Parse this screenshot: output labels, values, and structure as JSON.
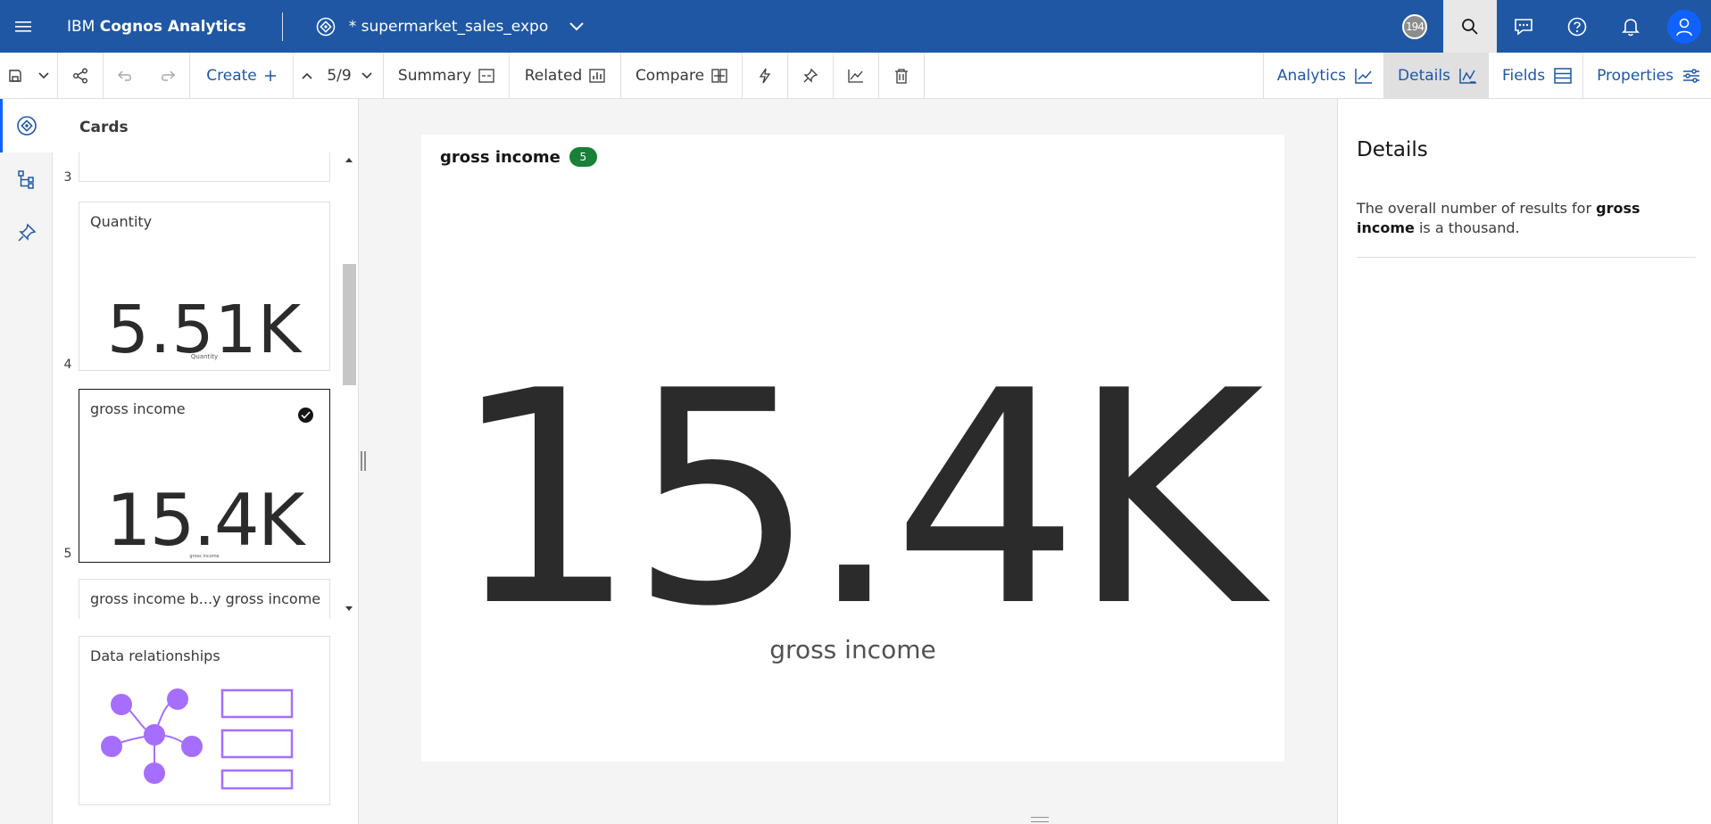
{
  "topbar": {
    "brand_prefix": "IBM ",
    "brand_name": "Cognos Analytics",
    "document_title": "* supermarket_sales_expo",
    "notification_count": "194"
  },
  "toolbar": {
    "create_label": "Create",
    "position": "5/9",
    "summary_label": "Summary",
    "related_label": "Related",
    "compare_label": "Compare",
    "analytics_label": "Analytics",
    "details_label": "Details",
    "fields_label": "Fields",
    "properties_label": "Properties"
  },
  "cards_panel": {
    "title": "Cards",
    "cards": [
      {
        "number": "3",
        "label": ""
      },
      {
        "number": "4",
        "label": "Quantity",
        "value": "5.51K",
        "sub": "Quantity"
      },
      {
        "number": "5",
        "label": "gross income",
        "value": "15.4K",
        "sub": "gross income",
        "selected": true
      },
      {
        "number": "",
        "label": "gross income b...y gross income"
      },
      {
        "number": "",
        "label": "Data relationships"
      }
    ]
  },
  "main_card": {
    "title": "gross income",
    "badge": "5",
    "value": "15.4K",
    "subtitle": "gross income"
  },
  "details": {
    "title": "Details",
    "text_prefix": "The overall number of results for ",
    "text_bold": "gross income",
    "text_suffix": " is a thousand."
  },
  "colors": {
    "topbar": "#1f57a4",
    "accent": "#0f62fe",
    "badge_green": "#198038",
    "relationship_purple": "#a56eff"
  }
}
